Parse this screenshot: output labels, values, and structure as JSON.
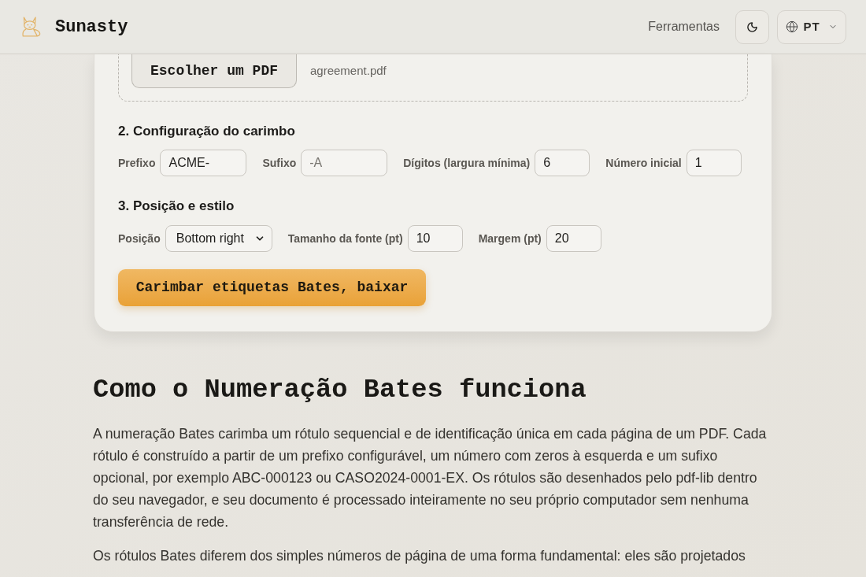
{
  "header": {
    "brand": "Sunasty",
    "nav_link": "Ferramentas",
    "language": "PT"
  },
  "upload": {
    "button": "Escolher um PDF",
    "file_name": "agreement.pdf"
  },
  "stamp_config": {
    "title": "2. Configuração do carimbo",
    "fields": [
      {
        "kind": "text",
        "label": "Prefixo",
        "value": "ACME-"
      },
      {
        "kind": "text",
        "label": "Sufixo",
        "placeholder": "-A"
      },
      {
        "kind": "number",
        "label": "Dígitos (largura mínima)",
        "value": "6"
      },
      {
        "kind": "number",
        "label": "Número inicial",
        "value": "1"
      }
    ]
  },
  "position_style": {
    "title": "3. Posição e estilo",
    "fields": [
      {
        "kind": "select",
        "label": "Posição",
        "value": "Bottom right"
      },
      {
        "kind": "number",
        "label": "Tamanho da fonte (pt)",
        "value": "10"
      },
      {
        "kind": "number",
        "label": "Margem (pt)",
        "value": "20"
      }
    ]
  },
  "submit_button": "Carimbar etiquetas Bates, baixar",
  "article": {
    "heading": "Como o Numeração Bates funciona",
    "paragraphs": [
      "A numeração Bates carimba um rótulo sequencial e de identificação única em cada página de um PDF. Cada rótulo é construído a partir de um prefixo configurável, um número com zeros à esquerda e um sufixo opcional, por exemplo ABC-000123 ou CASO2024-0001-EX. Os rótulos são desenhados pelo pdf-lib dentro do seu navegador, e seu documento é processado inteiramente no seu próprio computador sem nenhuma transferência de rede.",
      "Os rótulos Bates diferem dos simples números de página de uma forma fundamental: eles são projetados"
    ]
  }
}
